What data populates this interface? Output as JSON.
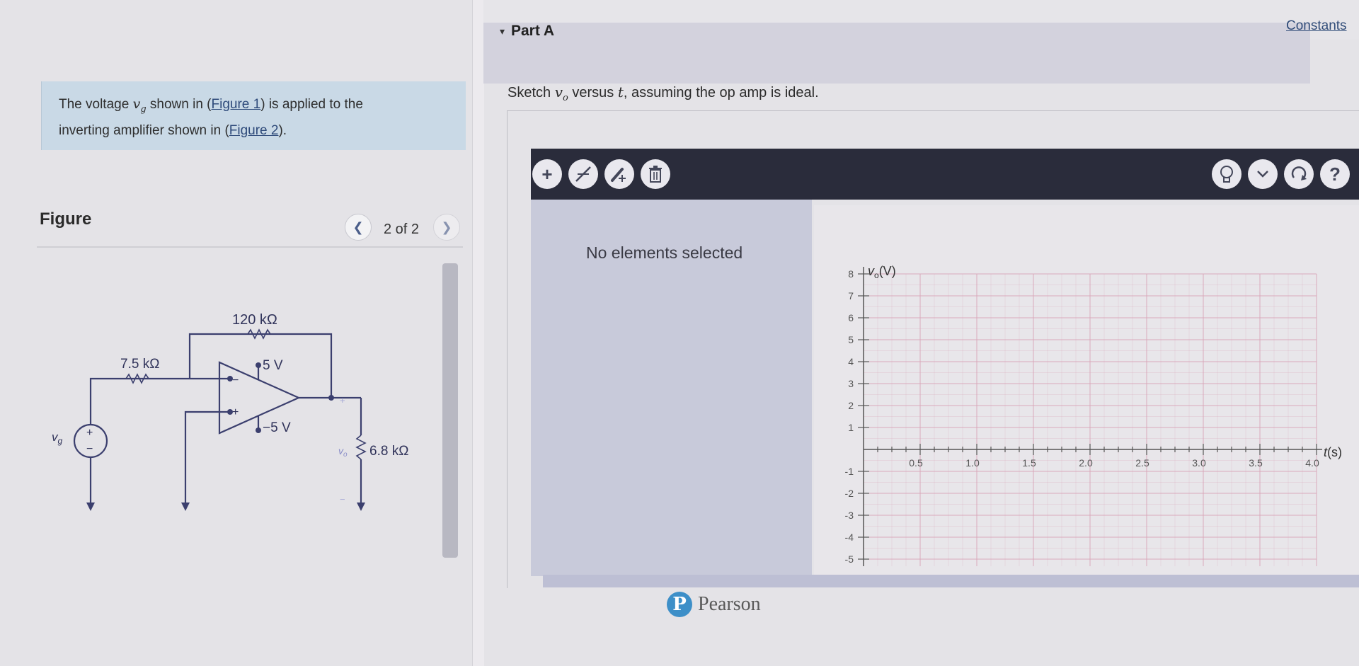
{
  "intro": {
    "text_a": "The voltage ",
    "var_vg": "v",
    "var_vg_sub": "g",
    "text_b": " shown in (",
    "figure1_link": "Figure 1",
    "text_c": ") is applied to the",
    "text_d": "inverting amplifier shown in (",
    "figure2_link": "Figure 2",
    "text_e": ")."
  },
  "figure": {
    "title": "Figure",
    "counter": "2 of 2",
    "prev_icon": "chevron-left-icon",
    "next_icon": "chevron-right-icon",
    "circuit": {
      "r_feedback": "120 kΩ",
      "r_input": "7.5 kΩ",
      "vcc": "5 V",
      "vee": "−5 V",
      "r_load": "6.8 kΩ",
      "source_label": "v",
      "source_sub": "g",
      "output_label": "v",
      "output_sub": "o",
      "plus": "+",
      "minus": "−"
    }
  },
  "part": {
    "label": "Part A",
    "constants_link": "Constants",
    "question_a": "Sketch ",
    "question_vo": "v",
    "question_vo_sub": "o",
    "question_b": " versus ",
    "question_t": "t",
    "question_c": ", assuming the op amp is ideal."
  },
  "toolbar": {
    "left_tools": [
      "add-icon",
      "draw-line-icon",
      "add-point-icon",
      "delete-icon"
    ],
    "right_tools": [
      "hint-bulb-icon",
      "dropdown-icon",
      "reset-icon",
      "help-icon"
    ],
    "help_glyph": "?"
  },
  "sidebar": {
    "status": "No elements selected"
  },
  "graph": {
    "y_axis_label": "v",
    "y_axis_sub": "o",
    "y_axis_unit": "(V)",
    "x_axis_label": "t",
    "x_axis_unit": "(s)",
    "y_ticks_pos": [
      "1",
      "2",
      "3",
      "4",
      "5",
      "6",
      "7",
      "8"
    ],
    "y_ticks_neg": [
      "-1",
      "-2",
      "-3",
      "-4",
      "-5"
    ],
    "x_ticks": [
      "0.5",
      "1.0",
      "1.5",
      "2.0",
      "2.5",
      "3.0",
      "3.5",
      "4.0"
    ],
    "grid_color": "#d9a4b8"
  },
  "footer": {
    "brand": "Pearson",
    "logo_glyph": "P"
  }
}
